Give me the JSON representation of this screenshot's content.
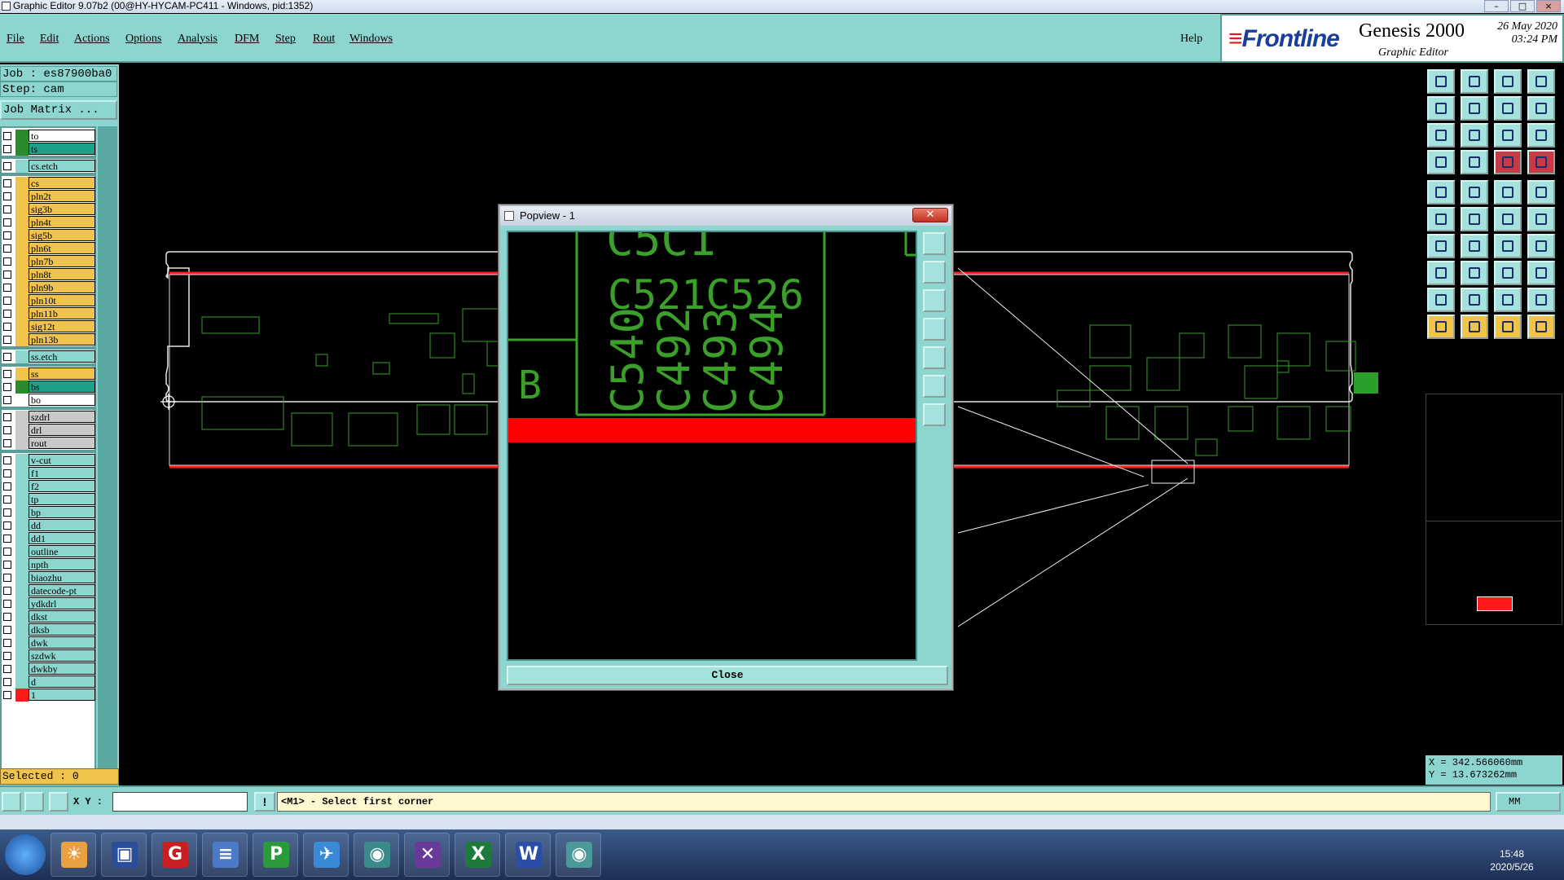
{
  "window": {
    "title": "Graphic Editor 9.07b2 (00@HY-HYCAM-PC411 - Windows, pid:1352)"
  },
  "menu": {
    "items": [
      {
        "label": "File"
      },
      {
        "label": "Edit"
      },
      {
        "label": "Actions"
      },
      {
        "label": "Options"
      },
      {
        "label": "Analysis"
      },
      {
        "label": "DFM"
      },
      {
        "label": "Step"
      },
      {
        "label": "Rout"
      },
      {
        "label": "Windows"
      }
    ],
    "help": "Help"
  },
  "logo": {
    "brand": "Frontline",
    "product": "Genesis 2000",
    "subtitle": "Graphic Editor",
    "date": "26 May 2020",
    "time": "03:24 PM"
  },
  "job": {
    "job_label": "Job : es87900ba0",
    "step_label": "Step: cam",
    "job_matrix": "Job Matrix ..."
  },
  "layers": [
    {
      "name": "to",
      "color": "#ffffff",
      "swatch": "#2b8a2b"
    },
    {
      "name": "ts",
      "color": "#1fa08a",
      "swatch": "#2b8a2b"
    },
    {
      "name": "cs.etch",
      "color": "#8dd6d0",
      "swatch": "#8dd6d0"
    },
    {
      "name": "cs",
      "color": "#f0c34c",
      "swatch": "#f0c34c"
    },
    {
      "name": "pln2t",
      "color": "#f0c34c",
      "swatch": "#f0c34c"
    },
    {
      "name": "sig3b",
      "color": "#f0c34c",
      "swatch": "#f0c34c"
    },
    {
      "name": "pln4t",
      "color": "#f0c34c",
      "swatch": "#f0c34c"
    },
    {
      "name": "sig5b",
      "color": "#f0c34c",
      "swatch": "#f0c34c"
    },
    {
      "name": "pln6t",
      "color": "#f0c34c",
      "swatch": "#f0c34c"
    },
    {
      "name": "pln7b",
      "color": "#f0c34c",
      "swatch": "#f0c34c"
    },
    {
      "name": "pln8t",
      "color": "#f0c34c",
      "swatch": "#f0c34c"
    },
    {
      "name": "pln9b",
      "color": "#f0c34c",
      "swatch": "#f0c34c"
    },
    {
      "name": "pln10t",
      "color": "#f0c34c",
      "swatch": "#f0c34c"
    },
    {
      "name": "pln11b",
      "color": "#f0c34c",
      "swatch": "#f0c34c"
    },
    {
      "name": "sig12t",
      "color": "#f0c34c",
      "swatch": "#f0c34c"
    },
    {
      "name": "pln13b",
      "color": "#f0c34c",
      "swatch": "#f0c34c"
    },
    {
      "name": "ss.etch",
      "color": "#8dd6d0",
      "swatch": "#8dd6d0"
    },
    {
      "name": "ss",
      "color": "#f0c34c",
      "swatch": "#f0c34c"
    },
    {
      "name": "bs",
      "color": "#1fa08a",
      "swatch": "#2b8a2b"
    },
    {
      "name": "bo",
      "color": "#ffffff",
      "swatch": "#ffffff"
    },
    {
      "name": "szdrl",
      "color": "#c9c9c9",
      "swatch": "#c9c9c9"
    },
    {
      "name": "drl",
      "color": "#c9c9c9",
      "swatch": "#c9c9c9"
    },
    {
      "name": "rout",
      "color": "#c9c9c9",
      "swatch": "#c9c9c9"
    },
    {
      "name": "v-cut",
      "color": "#8dd6d0",
      "swatch": "#8dd6d0"
    },
    {
      "name": "f1",
      "color": "#8dd6d0",
      "swatch": "#8dd6d0"
    },
    {
      "name": "f2",
      "color": "#8dd6d0",
      "swatch": "#8dd6d0"
    },
    {
      "name": "tp",
      "color": "#8dd6d0",
      "swatch": "#8dd6d0"
    },
    {
      "name": "bp",
      "color": "#8dd6d0",
      "swatch": "#8dd6d0"
    },
    {
      "name": "dd",
      "color": "#8dd6d0",
      "swatch": "#8dd6d0"
    },
    {
      "name": "dd1",
      "color": "#8dd6d0",
      "swatch": "#8dd6d0"
    },
    {
      "name": "outline",
      "color": "#8dd6d0",
      "swatch": "#8dd6d0"
    },
    {
      "name": "npth",
      "color": "#8dd6d0",
      "swatch": "#8dd6d0"
    },
    {
      "name": "biaozhu",
      "color": "#8dd6d0",
      "swatch": "#8dd6d0"
    },
    {
      "name": "datecode-pt",
      "color": "#8dd6d0",
      "swatch": "#8dd6d0"
    },
    {
      "name": "ydkdrl",
      "color": "#8dd6d0",
      "swatch": "#8dd6d0"
    },
    {
      "name": "dkst",
      "color": "#8dd6d0",
      "swatch": "#8dd6d0"
    },
    {
      "name": "dksb",
      "color": "#8dd6d0",
      "swatch": "#8dd6d0"
    },
    {
      "name": "dwk",
      "color": "#8dd6d0",
      "swatch": "#8dd6d0"
    },
    {
      "name": "szdwk",
      "color": "#8dd6d0",
      "swatch": "#8dd6d0"
    },
    {
      "name": "dwkby",
      "color": "#8dd6d0",
      "swatch": "#8dd6d0"
    },
    {
      "name": "d",
      "color": "#8dd6d0",
      "swatch": "#8dd6d0"
    },
    {
      "name": "1",
      "color": "#8dd6d0",
      "swatch": "#ff1a1a"
    }
  ],
  "status": {
    "selected": "Selected : 0"
  },
  "coords": {
    "x": "X = 342.566060mm",
    "y": "Y = 13.673262mm"
  },
  "command": {
    "xy_label": "X Y :",
    "xy_value": "",
    "prompt": "<M1> - Select first corner",
    "units": "MM"
  },
  "popview": {
    "title": "Popview - 1",
    "close_label": "Close",
    "texts": [
      "C521C526",
      "C540",
      "C492",
      "C493",
      "C494",
      "B"
    ]
  },
  "colors": {
    "panel": "#8dd6d0",
    "pcb_outline": "#ffffff",
    "copper": "#3aa02a",
    "highlight": "#ff0000"
  },
  "taskbar": {
    "time": "15:48",
    "date": "2020/5/26"
  }
}
